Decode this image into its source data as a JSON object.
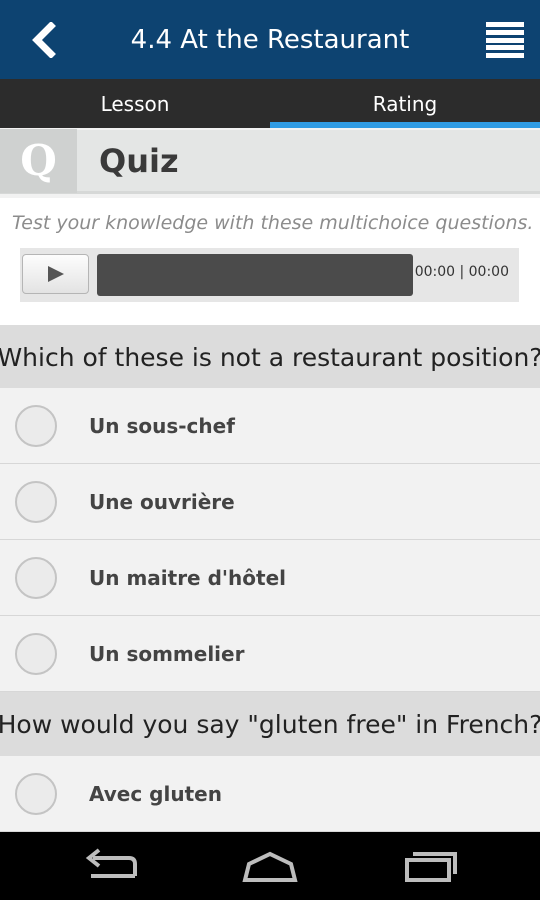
{
  "appbar": {
    "title": "4.4 At the Restaurant",
    "back_icon": "chevron-left-icon",
    "menu_icon": "menu-icon"
  },
  "tabs": [
    {
      "label": "Lesson",
      "active": false
    },
    {
      "label": "Rating",
      "active": true
    }
  ],
  "quiz": {
    "badge": "Q",
    "title": "Quiz"
  },
  "intro": {
    "text": "Test your knowledge with these multichoice questions."
  },
  "player": {
    "time": "00:00 | 00:00",
    "play_icon": "play-icon"
  },
  "questions": [
    {
      "text": "Which of these is not a restaurant position?",
      "options": [
        "Un sous-chef",
        "Une ouvrière",
        "Un maitre d'hôtel",
        "Un sommelier"
      ]
    },
    {
      "text": "How would you say \"gluten free\" in French?",
      "options": [
        "Avec gluten"
      ]
    }
  ],
  "navbar": {
    "back_icon": "nav-back-icon",
    "home_icon": "nav-home-icon",
    "recents_icon": "nav-recents-icon"
  },
  "colors": {
    "appbar": "#0d4371",
    "tab_indicator": "#2f9be3",
    "tabs_bg": "#2c2c2c"
  }
}
